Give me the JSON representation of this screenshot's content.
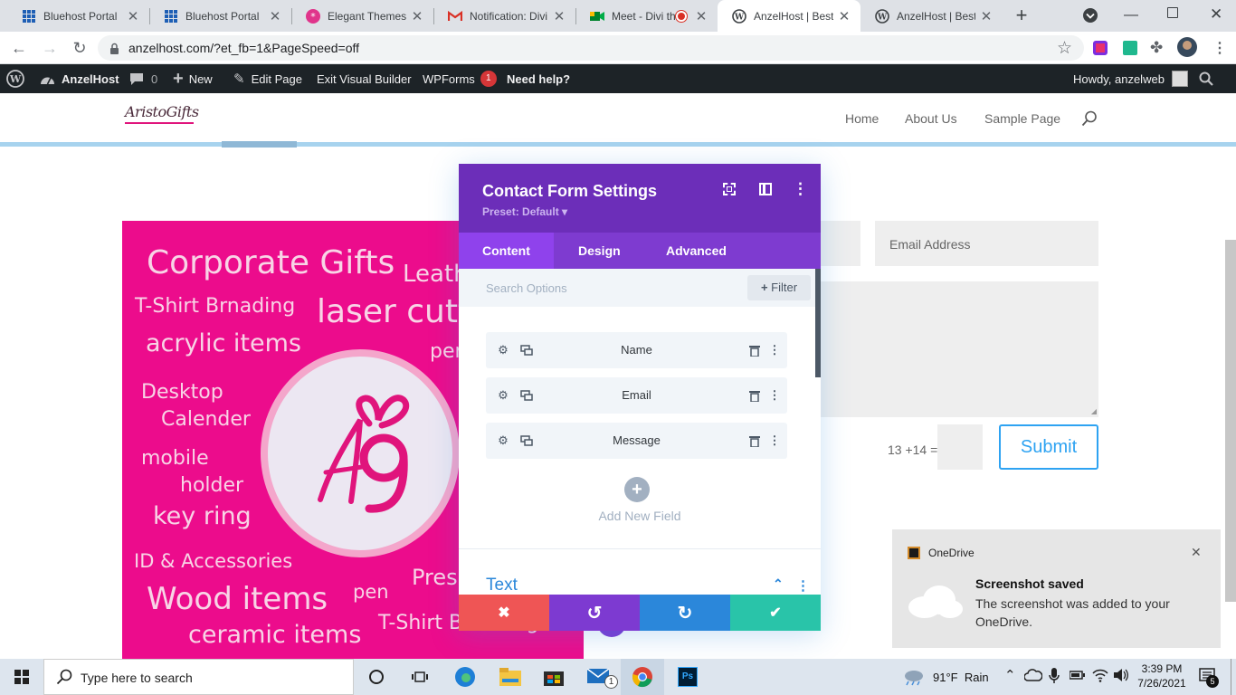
{
  "browser": {
    "tabs": [
      {
        "title": "Bluehost Portal",
        "icon": "bluehost-icon"
      },
      {
        "title": "Bluehost Portal",
        "icon": "bluehost-icon"
      },
      {
        "title": "Elegant Themes M",
        "icon": "elegant-themes-icon"
      },
      {
        "title": "Notification: Divi",
        "icon": "gmail-icon"
      },
      {
        "title": "Meet - Divi th",
        "icon": "meet-icon"
      },
      {
        "title": "AnzelHost | Best \\",
        "icon": "wordpress-icon",
        "active": true
      },
      {
        "title": "AnzelHost | Best \\",
        "icon": "wordpress-icon"
      }
    ],
    "new_tab": "+",
    "url": "anzelhost.com/?et_fb=1&PageSpeed=off"
  },
  "wp_admin_bar": {
    "site_name": "AnzelHost",
    "comments_count": "0",
    "new_label": "New",
    "edit_page_label": "Edit Page",
    "exit_builder_label": "Exit Visual Builder",
    "wpforms_label": "WPForms",
    "wpforms_badge": "1",
    "help_label": "Need help?",
    "howdy_label": "Howdy, anzelweb"
  },
  "site": {
    "logo_text": "AristoGifts",
    "menu": [
      "Home",
      "About Us",
      "Sample Page"
    ]
  },
  "hero_words": [
    "Corporate Gifts",
    "Leath",
    "T-Shirt Brnading",
    "laser cutt",
    "acrylic items",
    "per",
    "Desktop",
    "Calender",
    "mobile",
    "holder",
    "key ring",
    "ID & Accessories",
    "Pres",
    "Wood items",
    "pen",
    "ceramic items",
    "T-Shirt Branding"
  ],
  "contact_form": {
    "email_placeholder": "Email Address",
    "captcha": "13 +14 =",
    "submit_label": "Submit"
  },
  "modal": {
    "title": "Contact Form Settings",
    "preset": "Preset: Default",
    "tabs": [
      "Content",
      "Design",
      "Advanced"
    ],
    "search_placeholder": "Search Options",
    "filter_label": "Filter",
    "fields": [
      "Name",
      "Email",
      "Message"
    ],
    "add_field_label": "Add New Field",
    "section_title": "Text"
  },
  "toast": {
    "app_name": "OneDrive",
    "title": "Screenshot saved",
    "message": "The screenshot was added to your OneDrive."
  },
  "taskbar": {
    "search_placeholder": "Type here to search",
    "mail_badge": "1",
    "weather": "91°F  Rain",
    "time": "3:39 PM",
    "date": "7/26/2021",
    "notification_count": "5"
  },
  "colors": {
    "divi_purple": "#6c2eb9",
    "divi_tab_purple": "#7e3bd0",
    "hero_pink": "#ec0c8c",
    "cancel_red": "#ef5555",
    "undo_purple": "#7d3ad1",
    "redo_blue": "#2b87da",
    "save_green": "#29c4a9",
    "submit_blue": "#2ea3f2"
  }
}
